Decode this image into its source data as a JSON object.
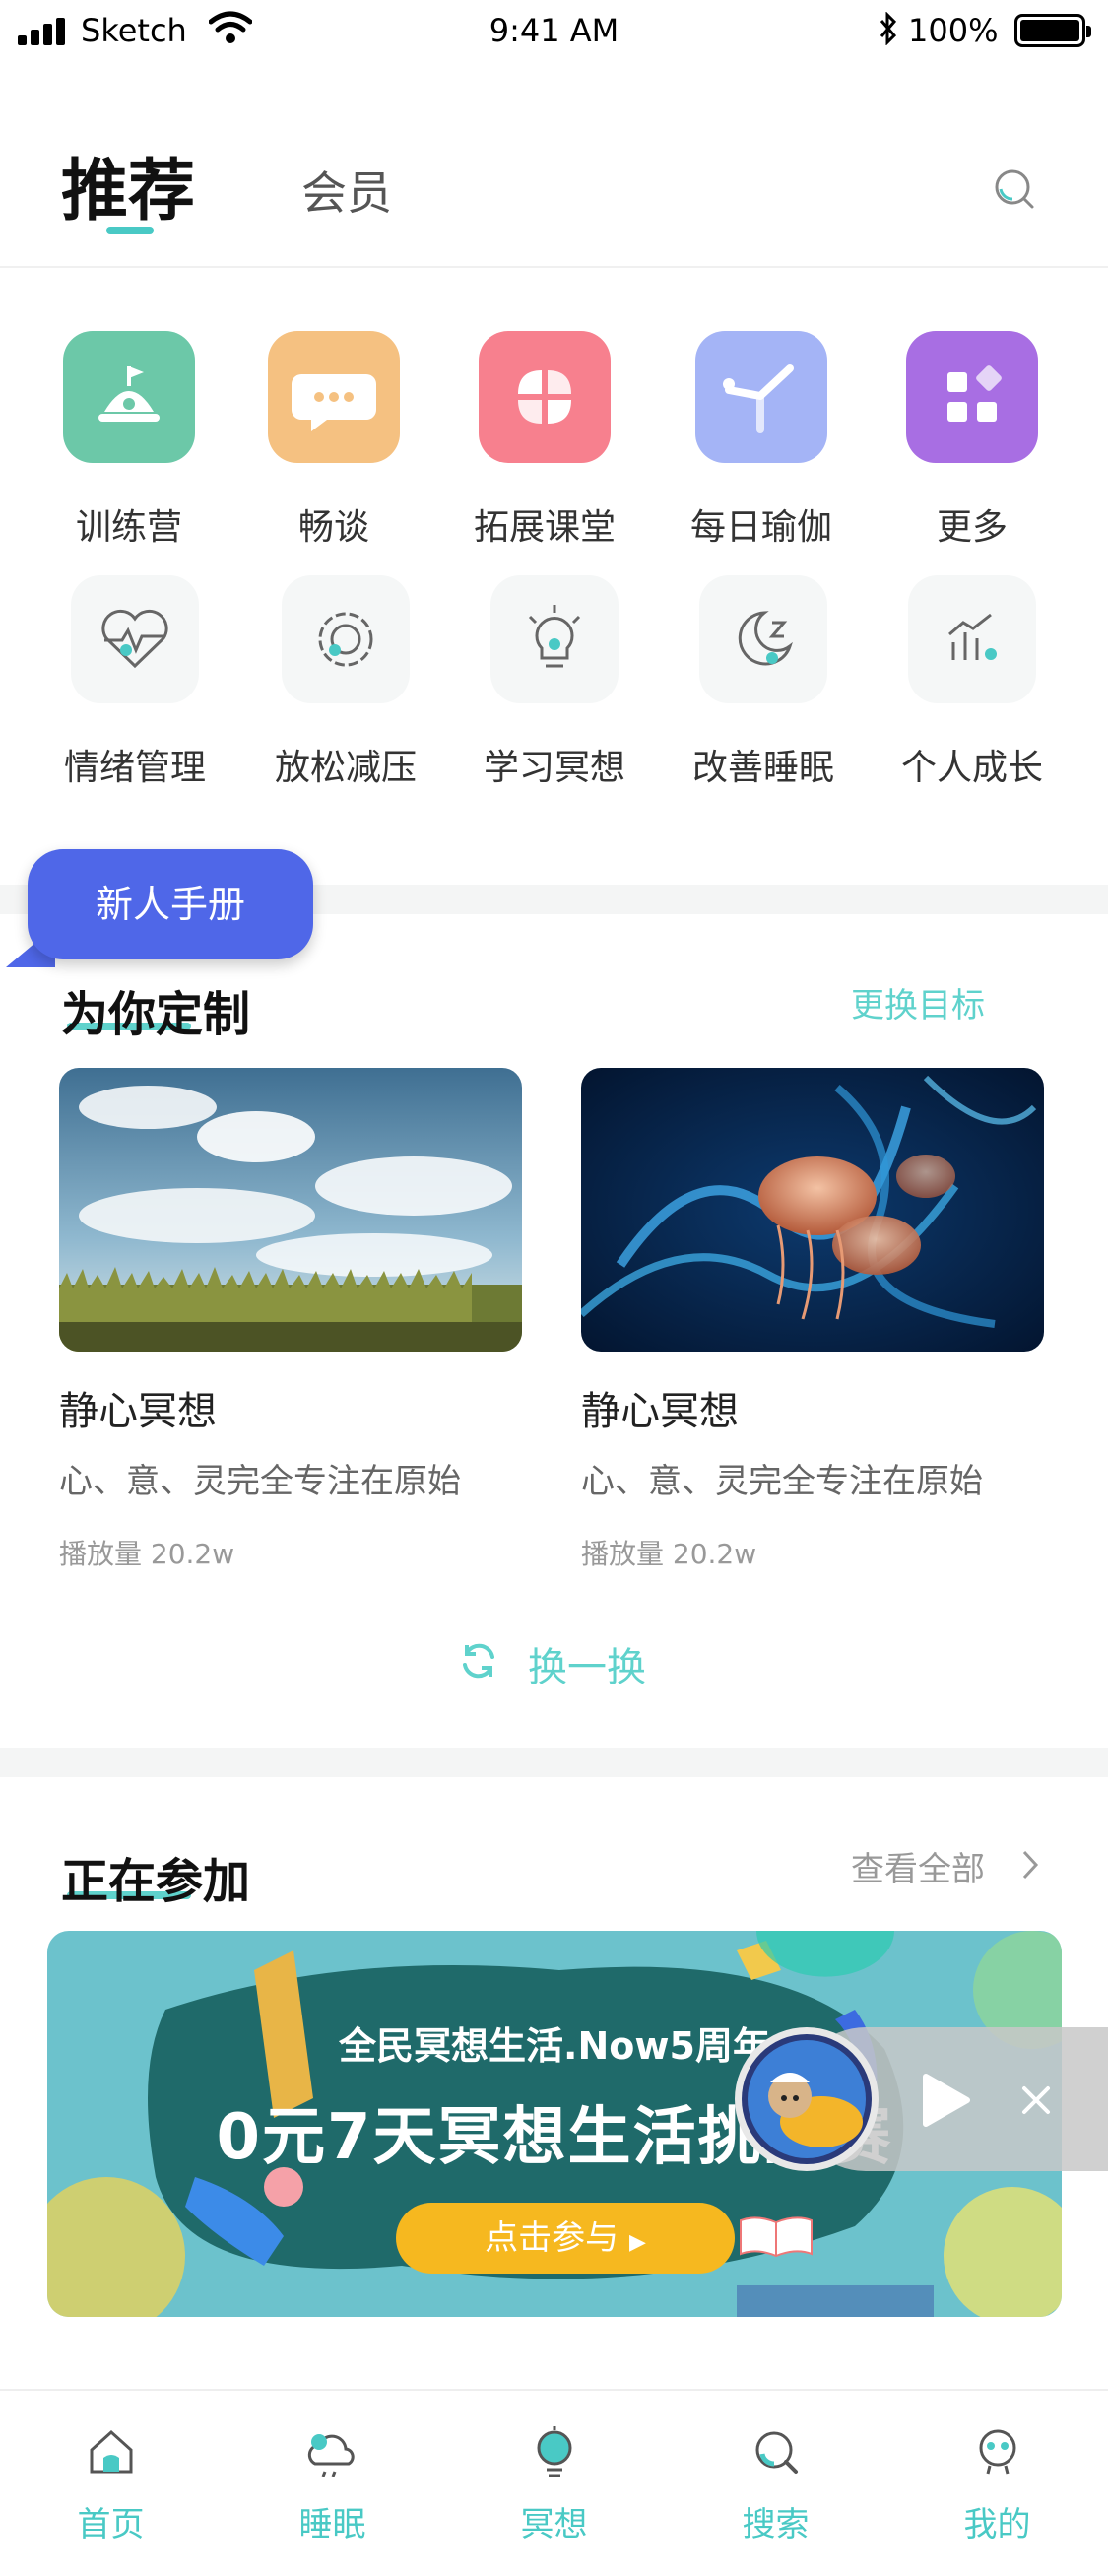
{
  "status_bar": {
    "carrier": "Sketch",
    "time": "9:41 AM",
    "battery": "100%"
  },
  "header": {
    "tab_recommend": "推荐",
    "tab_member": "会员"
  },
  "grid_row1": [
    {
      "label": "训练营",
      "icon": "camp-bell-icon",
      "color": "#6cc8a8"
    },
    {
      "label": "畅谈",
      "icon": "chat-bubble-icon",
      "color": "#f5c181"
    },
    {
      "label": "拓展课堂",
      "icon": "pinwheel-icon",
      "color": "#f7808e"
    },
    {
      "label": "每日瑜伽",
      "icon": "yoga-pose-icon",
      "color": "#a4b4f6"
    },
    {
      "label": "更多",
      "icon": "more-grid-icon",
      "color": "#a86ee3"
    }
  ],
  "grid_row2": [
    {
      "label": "情绪管理",
      "icon": "heart-pulse-icon"
    },
    {
      "label": "放松减压",
      "icon": "gear-flower-icon"
    },
    {
      "label": "学习冥想",
      "icon": "lightbulb-icon"
    },
    {
      "label": "改善睡眠",
      "icon": "moon-z-icon"
    },
    {
      "label": "个人成长",
      "icon": "growth-chart-icon"
    }
  ],
  "tooltip": {
    "text": "新人手册"
  },
  "custom_section": {
    "title": "为你定制",
    "action": "更换目标",
    "cards": [
      {
        "title": "静心冥想",
        "desc": "心、意、灵完全专注在原始",
        "plays": "播放量 20.2w",
        "image": "sky-wheat-field"
      },
      {
        "title": "静心冥想",
        "desc": "心、意、灵完全专注在原始",
        "plays": "播放量 20.2w",
        "image": "blue-jellyfish"
      }
    ],
    "refresh": "换一换"
  },
  "joining_section": {
    "title": "正在参加",
    "action": "查看全部",
    "banner": {
      "subtitle": "全民冥想生活.Now5周年",
      "headline": "0元7天冥想生活挑战赛",
      "cta": "点击参与"
    }
  },
  "tabbar": [
    {
      "label": "首页",
      "icon": "home-icon"
    },
    {
      "label": "睡眠",
      "icon": "sleep-cloud-icon"
    },
    {
      "label": "冥想",
      "icon": "meditation-bulb-icon"
    },
    {
      "label": "搜索",
      "icon": "search-tab-icon"
    },
    {
      "label": "我的",
      "icon": "profile-face-icon"
    }
  ],
  "colors": {
    "accent": "#49c9c5",
    "tooltip": "#4f67e8"
  }
}
